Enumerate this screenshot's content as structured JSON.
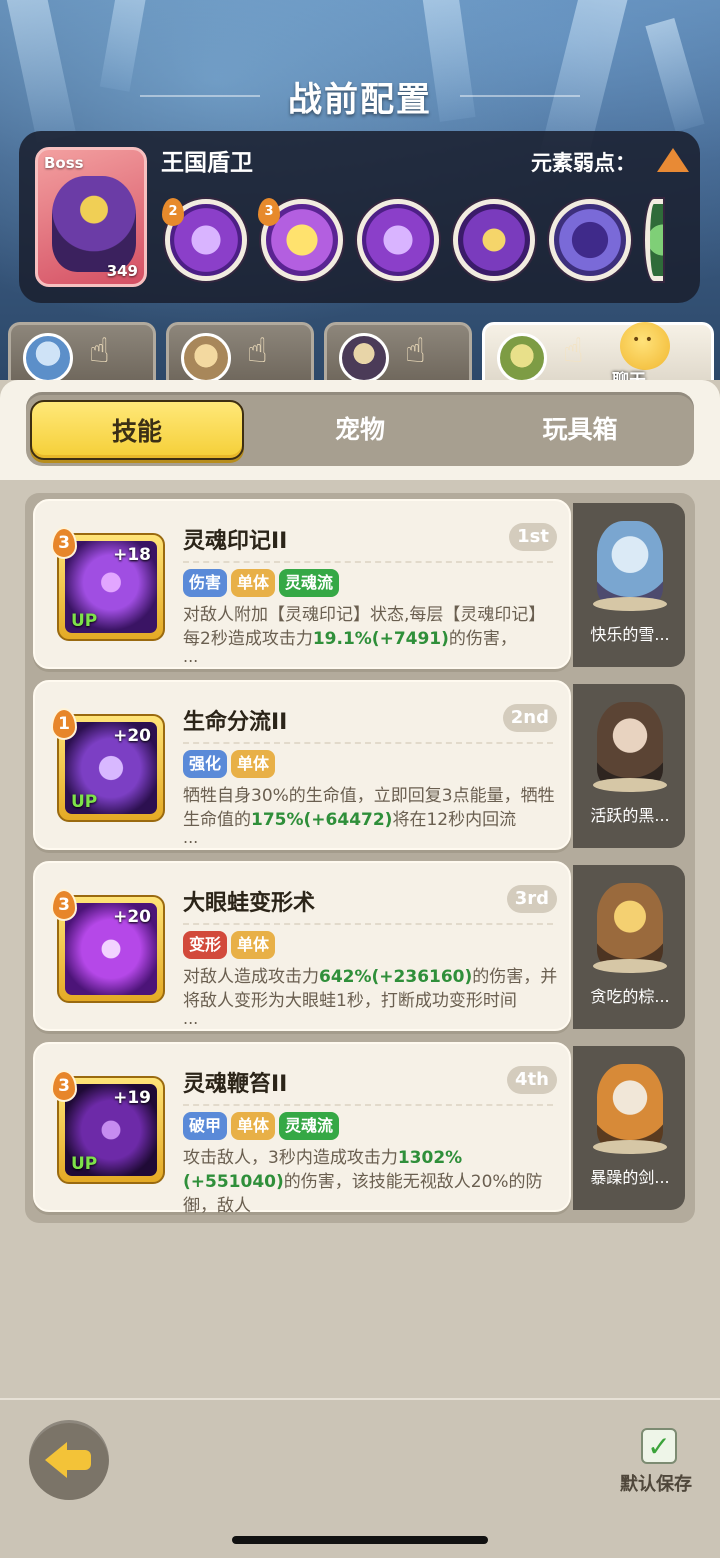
{
  "header": {
    "title": "战前配置"
  },
  "boss": {
    "tag": "Boss",
    "level": "349",
    "name": "王国盾卫",
    "weakness_label": "元素弱点：",
    "weakness_icon": "earth-element-icon",
    "skills": [
      {
        "level": "2"
      },
      {
        "level": "3"
      },
      {
        "level": ""
      },
      {
        "level": ""
      },
      {
        "level": ""
      }
    ]
  },
  "chat": {
    "label": "聊天"
  },
  "tabs": {
    "skills": "技能",
    "pets": "宠物",
    "toybox": "玩具箱"
  },
  "skills": [
    {
      "name": "灵魂印记II",
      "rank": "1st",
      "level": "3",
      "plus": "+18",
      "up": "UP",
      "tags": [
        "伤害",
        "单体",
        "灵魂流"
      ],
      "desc_a": "对敌人附加【灵魂印记】状态,每层【灵魂印记】每2秒造成攻击力",
      "desc_hl1": "19.1%(+7491)",
      "desc_b": "的伤害，",
      "ellipsis": "...",
      "pet": "快乐的雪..."
    },
    {
      "name": "生命分流II",
      "rank": "2nd",
      "level": "1",
      "plus": "+20",
      "up": "UP",
      "tags": [
        "强化",
        "单体"
      ],
      "desc_a": "牺牲自身30%的生命值，立即回复3点能量，牺牲生命值的",
      "desc_hl1": "175%(+64472)",
      "desc_b": "将在12秒内回流",
      "ellipsis": "...",
      "pet": "活跃的黑..."
    },
    {
      "name": "大眼蛙变形术",
      "rank": "3rd",
      "level": "3",
      "plus": "+20",
      "up": "",
      "tags": [
        "变形",
        "单体"
      ],
      "desc_a": "对敌人造成攻击力",
      "desc_hl1": "642%(+236160)",
      "desc_b": "的伤害，并将敌人变形为大眼蛙1秒，打断成功变形时间",
      "ellipsis": "...",
      "pet": "贪吃的棕..."
    },
    {
      "name": "灵魂鞭笞II",
      "rank": "4th",
      "level": "3",
      "plus": "+19",
      "up": "UP",
      "tags": [
        "破甲",
        "单体",
        "灵魂流"
      ],
      "desc_a": "攻击敌人，3秒内造成攻击力",
      "desc_hl1": "1302%(+551040)",
      "desc_b": "的伤害，该技能无视敌人20%的防御，敌人",
      "ellipsis": "...",
      "pet": "暴躁的剑..."
    }
  ],
  "bottom": {
    "save_label": "默认保存",
    "save_checked": true
  }
}
